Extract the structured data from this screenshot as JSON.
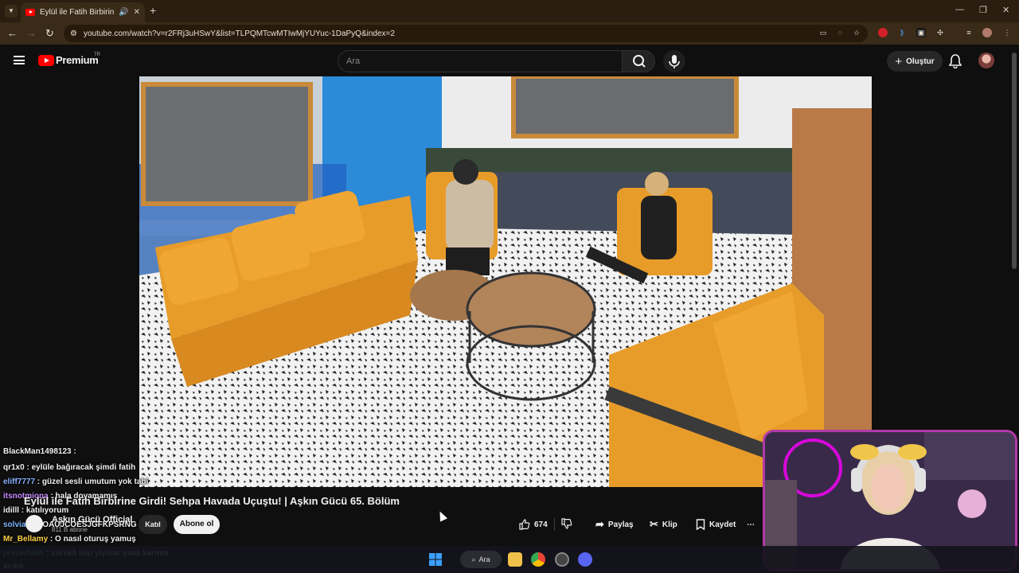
{
  "browser": {
    "tab_title": "Eylül ile Fatih Birbirine Girdi",
    "new_tab_symbol": "+",
    "tab_close_symbol": "✕",
    "url": "youtube.com/watch?v=r2FRj3uHSwY&list=TLPQMTcwMTIwMjYUYuc-1DaPyQ&index=2"
  },
  "youtube": {
    "logo_text": "Premium",
    "logo_region": "TR",
    "search_placeholder": "Ara",
    "create_label": "Oluştur"
  },
  "video": {
    "title": "Eylül ile Fatih Birbirine Girdi! Sehpa Havada Uçuştu! | Aşkın Gücü 65. Bölüm",
    "channel": "Aşkın Gücü Official",
    "subscribers": "811 B abone",
    "join_label": "Katıl",
    "subscribe_label": "Abone ol",
    "like_count": "674",
    "share_label": "Paylaş",
    "clip_label": "Klip",
    "save_label": "Kaydet",
    "more_symbol": "⋯"
  },
  "chat": [
    {
      "user": "BlackMan1498123",
      "text": " : ",
      "color": "#f1f1f1"
    },
    {
      "user": "qr1x0",
      "text": " : eylüle bağıracak şimdi fatih",
      "color": "#f1f1f1"
    },
    {
      "user": "eliff7777",
      "text": " : güzel sesli umutum yok tabi",
      "color": "#8ab4ff"
    },
    {
      "user": "itsnotmiona",
      "text": " : hala doyamamış",
      "color": "#c78bff"
    },
    {
      "user": "idilll",
      "text": " : katılıyorum",
      "color": "#f1f1f1"
    },
    {
      "user": "solviaa",
      "text": " : YOAUJCOESJGFKPSRNG",
      "color": "#7fb4ff"
    },
    {
      "user": "Mr_Bellamy",
      "text": " : O nasıl oturuş yamuş",
      "color": "#ffd24a"
    },
    {
      "user": "prezerfatih",
      "text": " : sürekli bişi yiyolar yaaa karnım",
      "color": "#7cff7c"
    },
    {
      "user": "",
      "text": "acıktı",
      "color": "#f1f1f1"
    }
  ],
  "taskbar": {
    "search_label": "Ara"
  },
  "colors": {
    "browser_frame": "#2b1d0f",
    "toolbar": "#3a2a18",
    "yt_red": "#ff0000",
    "webcam_border": "#b03aa8"
  }
}
